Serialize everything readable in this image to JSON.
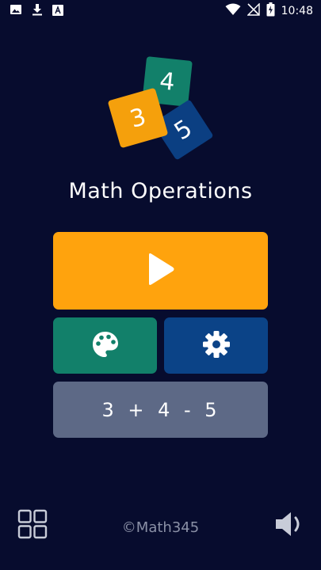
{
  "status_bar": {
    "time": "10:48",
    "left_icons": [
      "image-icon",
      "download-icon",
      "font-icon"
    ],
    "right_icons": [
      "wifi-icon",
      "no-signal-icon",
      "battery-charging-icon"
    ]
  },
  "logo": {
    "tiles": [
      "3",
      "4",
      "5"
    ],
    "colors": {
      "three": "#f5a00c",
      "four": "#12806a",
      "five": "#0b3f82"
    }
  },
  "app": {
    "title": "Math Operations"
  },
  "buttons": {
    "play_icon": "play-icon",
    "theme_icon": "palette-icon",
    "settings_icon": "gear-icon",
    "equation_label": "3 + 4 - 5"
  },
  "footer": {
    "copyright": "©Math345",
    "left_icon": "grid-icon",
    "right_icon": "speaker-icon"
  },
  "colors": {
    "background": "#070c2e",
    "play": "#ffa30d",
    "theme": "#12806a",
    "settings": "#0b4387",
    "equation": "#5d6986"
  }
}
